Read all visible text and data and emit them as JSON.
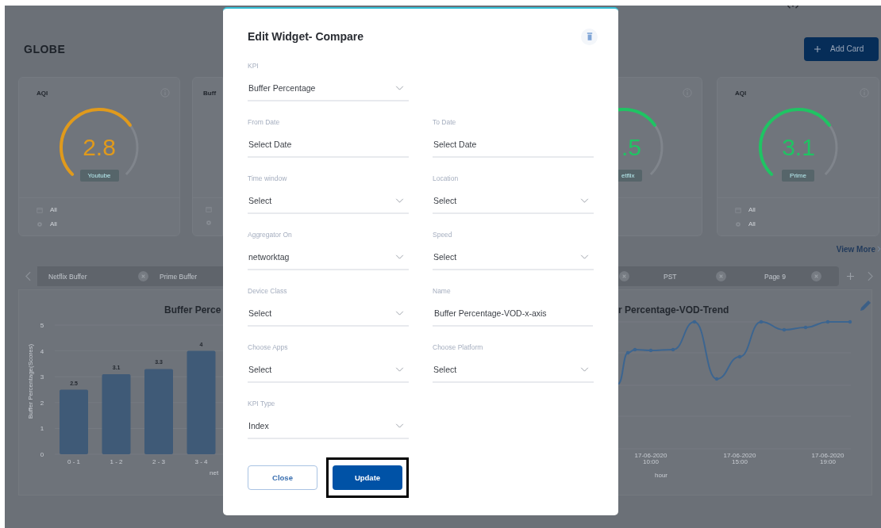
{
  "header": {
    "title": "GLOBE",
    "add_button": "Add Card"
  },
  "cards": [
    {
      "kind": "full",
      "title": "AQI",
      "value": "2.8",
      "badge": "Youtube",
      "color": "#e09a1c",
      "filters": [
        "All",
        "All"
      ]
    },
    {
      "kind": "cut_right",
      "title": "Buff"
    },
    {
      "kind": "cut_left",
      "value": ".5",
      "badge": "etflix",
      "color": "#1fc463"
    },
    {
      "kind": "full",
      "title": "AQI",
      "value": "3.1",
      "badge": "Prime",
      "color": "#1fc463",
      "filters": [
        "All",
        "All"
      ]
    }
  ],
  "view_more": "View More",
  "left_tabs": [
    {
      "label": "Netflix Buffer"
    },
    {
      "label": "Prime Buffer"
    }
  ],
  "right_tabs": [
    {
      "label": "PST"
    },
    {
      "label": "Page 9"
    }
  ],
  "left_chart": {
    "chart_data": {
      "type": "bar",
      "title": "Buffer Perce",
      "xlabel": "net",
      "ylabel": "Buffer Percentage(Scores)",
      "categories": [
        "0 - 1",
        "1 - 2",
        "2 - 3",
        "3 - 4"
      ],
      "values": [
        2.5,
        3.1,
        3.3,
        4
      ],
      "ylim": [
        0,
        5
      ],
      "yticks": [
        0,
        1,
        2,
        3,
        4,
        5
      ],
      "data_labels": true
    }
  },
  "right_chart": {
    "title": "r Percentage-VOD-Trend",
    "xlabel": "hour",
    "x_ticks": [
      {
        "date": "17-06-2020",
        "time": "10:00"
      },
      {
        "date": "17-06-2020",
        "time": "15:00"
      },
      {
        "date": "17-06-2020",
        "time": "19:00"
      }
    ]
  },
  "modal": {
    "title": "Edit Widget- Compare",
    "rows": [
      {
        "fields": [
          {
            "kind": "select",
            "label": "KPI",
            "value": "Buffer Percentage"
          }
        ]
      },
      {
        "fields": [
          {
            "kind": "date",
            "label": "From Date",
            "value": "Select Date"
          },
          {
            "kind": "date",
            "label": "To Date",
            "value": "Select Date"
          }
        ]
      },
      {
        "fields": [
          {
            "kind": "select",
            "label": "Time window",
            "value": "Select"
          },
          {
            "kind": "select",
            "label": "Location",
            "value": "Select"
          }
        ]
      },
      {
        "fields": [
          {
            "kind": "select",
            "label": "Aggregator On",
            "value": "networktag"
          },
          {
            "kind": "select",
            "label": "Speed",
            "value": "Select"
          }
        ]
      },
      {
        "fields": [
          {
            "kind": "select",
            "label": "Device Class",
            "value": "Select"
          },
          {
            "kind": "text",
            "label": "Name",
            "value": "Buffer Percentage-VOD-x-axis"
          }
        ]
      },
      {
        "fields": [
          {
            "kind": "select",
            "label": "Choose Apps",
            "value": "Select"
          },
          {
            "kind": "select",
            "label": "Choose Platform",
            "value": "Select"
          }
        ]
      },
      {
        "fields": [
          {
            "kind": "select",
            "label": "KPI Type",
            "value": "Index"
          }
        ]
      }
    ],
    "buttons": [
      {
        "kind": "secondary",
        "label": "Close",
        "highlighted": false
      },
      {
        "kind": "primary",
        "label": "Update",
        "highlighted": true
      }
    ]
  }
}
